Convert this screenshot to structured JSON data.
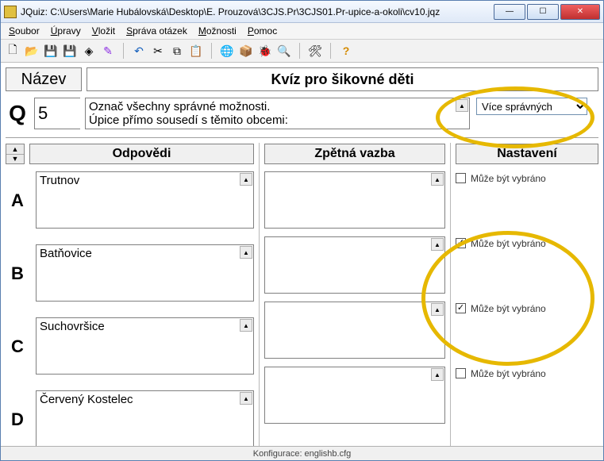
{
  "title": "JQuiz: C:\\Users\\Marie Hubálovská\\Desktop\\E. Prouzová\\3CJS.Pr\\3CJS01.Pr-upice-a-okoli\\cv10.jqz",
  "menu": {
    "soubor": "Soubor",
    "upravy": "Úpravy",
    "vlozit": "Vložit",
    "sprava": "Správa otázek",
    "moznosti": "Možnosti",
    "pomoc": "Pomoc"
  },
  "labels": {
    "nazev": "Název",
    "odpovedi": "Odpovědi",
    "zpetna": "Zpětná vazba",
    "nastaveni": "Nastavení",
    "q": "Q",
    "muze": "Může být vybráno"
  },
  "quiz": {
    "title": "Kvíz pro šikovné děti",
    "qnum": "5",
    "question": "Označ všechny správné možnosti.\nÚpice přímo sousedí s těmito obcemi:",
    "type": "Více správných"
  },
  "answers": [
    {
      "letter": "A",
      "text": "Trutnov",
      "checked": false
    },
    {
      "letter": "B",
      "text": "Batňovice",
      "checked": true
    },
    {
      "letter": "C",
      "text": "Suchovršice",
      "checked": true
    },
    {
      "letter": "D",
      "text": "Červený Kostelec",
      "checked": false
    }
  ],
  "status": "Konfigurace: englishb.cfg"
}
